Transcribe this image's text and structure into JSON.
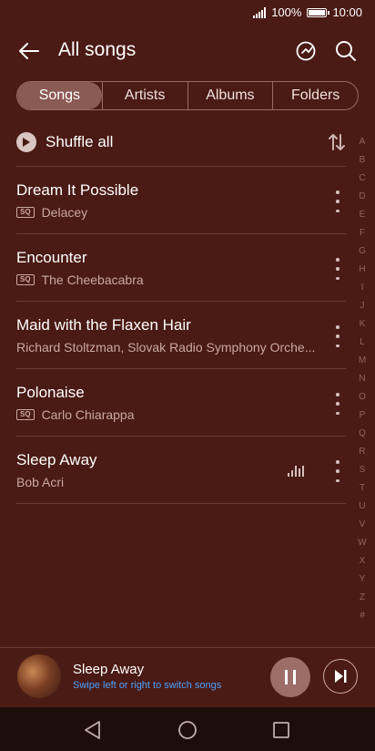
{
  "status": {
    "battery_percent": "100%",
    "battery_level": 1.0,
    "time": "10:00"
  },
  "header": {
    "title": "All songs"
  },
  "tabs": [
    {
      "label": "Songs",
      "active": true
    },
    {
      "label": "Artists",
      "active": false
    },
    {
      "label": "Albums",
      "active": false
    },
    {
      "label": "Folders",
      "active": false
    }
  ],
  "shuffle": {
    "label": "Shuffle all"
  },
  "songs": [
    {
      "title": "Dream It Possible",
      "artist": "Delacey",
      "badge": "SQ"
    },
    {
      "title": "Encounter",
      "artist": "The Cheebacabra",
      "badge": "SQ"
    },
    {
      "title": "Maid with the Flaxen Hair",
      "artist": "Richard Stoltzman, Slovak Radio Symphony Orche...",
      "badge": ""
    },
    {
      "title": "Polonaise",
      "artist": "Carlo Chiarappa",
      "badge": "SQ"
    },
    {
      "title": "Sleep Away",
      "artist": "Bob Acri",
      "badge": "",
      "playing": true
    }
  ],
  "alphabet": [
    "A",
    "B",
    "C",
    "D",
    "E",
    "F",
    "G",
    "H",
    "I",
    "J",
    "K",
    "L",
    "M",
    "N",
    "O",
    "P",
    "Q",
    "R",
    "S",
    "T",
    "U",
    "V",
    "W",
    "X",
    "Y",
    "Z",
    "#"
  ],
  "mini_player": {
    "title": "Sleep Away",
    "hint": "Swipe left or right to switch songs"
  },
  "colors": {
    "background": "#4a1a14",
    "accent_link": "#4aa3ff",
    "active_tab": "#8a5a53"
  }
}
